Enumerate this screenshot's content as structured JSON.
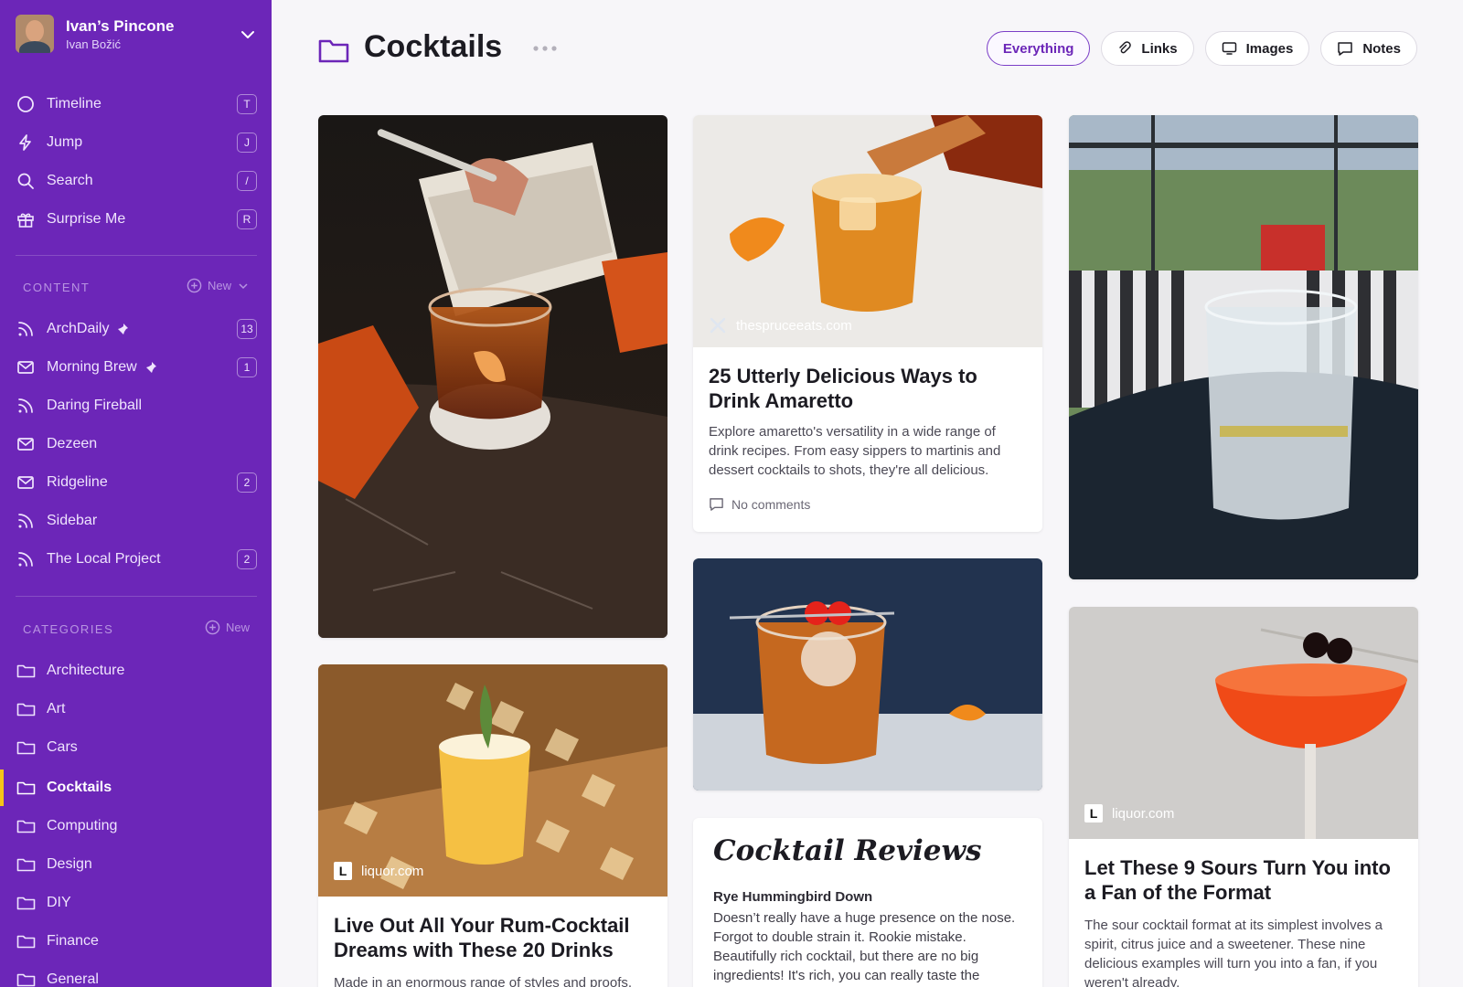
{
  "account": {
    "name": "Ivan’s Pincone",
    "user": "Ivan Božić"
  },
  "nav": [
    {
      "label": "Timeline",
      "key": "T"
    },
    {
      "label": "Jump",
      "key": "J"
    },
    {
      "label": "Search",
      "key": "/"
    },
    {
      "label": "Surprise Me",
      "key": "R"
    }
  ],
  "content": {
    "heading": "CONTENT",
    "new_label": "New",
    "items": [
      {
        "label": "ArchDaily",
        "count": "13"
      },
      {
        "label": "Morning Brew",
        "count": "1"
      },
      {
        "label": "Daring Fireball"
      },
      {
        "label": "Dezeen"
      },
      {
        "label": "Ridgeline",
        "count": "2"
      },
      {
        "label": "Sidebar"
      },
      {
        "label": "The Local Project",
        "count": "2"
      }
    ]
  },
  "categories": {
    "heading": "CATEGORIES",
    "new_label": "New",
    "items": [
      "Architecture",
      "Art",
      "Cars",
      "Cocktails",
      "Computing",
      "Design",
      "DIY",
      "Finance",
      "General"
    ],
    "active": "Cocktails"
  },
  "header": {
    "title": "Cocktails"
  },
  "filters": [
    "Everything",
    "Links",
    "Images",
    "Notes"
  ],
  "cards": {
    "amaretto": {
      "source": "thespruceeats.com",
      "title": "25 Utterly Delicious Ways to Drink Amaretto",
      "desc": "Explore amaretto's versatility in a wide range of drink recipes. From easy sippers to martinis and dessert cocktails to shots, they're all delicious.",
      "comments": "No comments"
    },
    "rum": {
      "source": "liquor.com",
      "title": "Live Out All Your Rum-Cocktail Dreams with These 20 Drinks",
      "desc": "Made in an enormous range of styles and proofs,"
    },
    "note": {
      "title": "Cocktail Reviews",
      "subtitle": "Rye Hummingbird Down",
      "body": "Doesn’t really have a huge presence on the nose. Forgot to double strain it. Rookie mistake. Beautifully rich cocktail, but there are no big ingredients! It's rich, you can really taste the whiskey but it's offset by the honey syrup and"
    },
    "sours": {
      "source": "liquor.com",
      "title": "Let These 9 Sours Turn You into a Fan of the Format",
      "desc": "The sour cocktail format at its simplest involves a spirit, citrus juice and a sweetener. These nine delicious examples will turn you into a fan, if you weren't already."
    }
  },
  "colors": {
    "sidebar": "#6c26b8",
    "accent": "#7b3ec7",
    "active_marker": "#f5c518"
  }
}
